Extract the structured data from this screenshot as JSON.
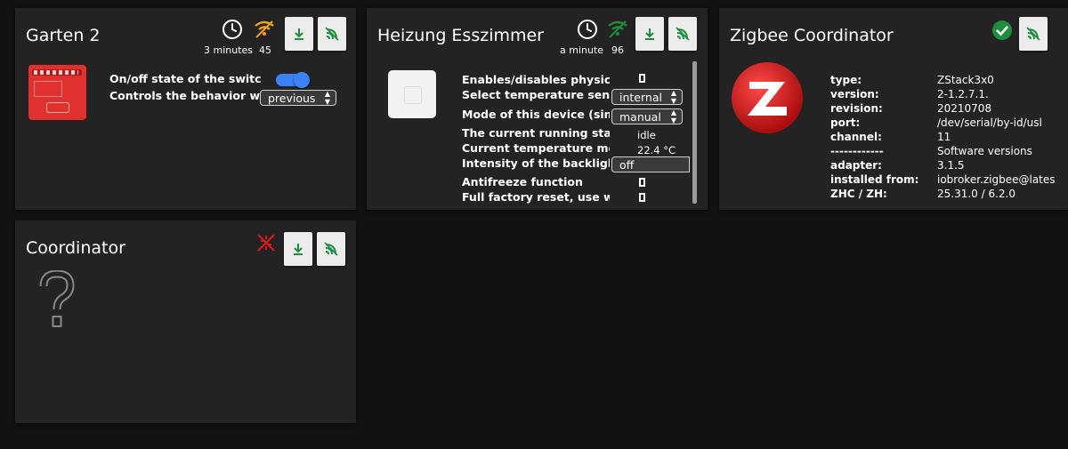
{
  "colors": {
    "background": "#121212",
    "card": "#232323",
    "link_ok": "#1e8e3e",
    "link_medium": "#f0a020",
    "error": "#e01818",
    "toggle": "#3b82f6"
  },
  "cards": {
    "garten": {
      "title": "Garten 2",
      "last_seen": "3 minutes",
      "link_quality": "45",
      "icons": [
        "clock-icon",
        "wifi-icon",
        "download-icon",
        "signal-icon"
      ],
      "rows": [
        {
          "label": "On/off state of the switch",
          "type": "toggle",
          "checked": true
        },
        {
          "label": "Controls the behavior w...",
          "type": "select",
          "value": "previous"
        }
      ]
    },
    "heizung": {
      "title": "Heizung Esszimmer",
      "last_seen": "a minute",
      "link_quality": "96",
      "icons": [
        "clock-icon",
        "wifi-icon",
        "download-icon",
        "signal-icon"
      ],
      "rows": [
        {
          "label": "Enables/disables physic...",
          "type": "checkbox"
        },
        {
          "label": "Select temperature sens...",
          "type": "select",
          "value": "internal"
        },
        {
          "label": "Mode of this device (sim...",
          "type": "select",
          "value": "manual"
        },
        {
          "label": "The current running state",
          "type": "text",
          "value": "idle"
        },
        {
          "label": "Current temperature me...",
          "type": "text",
          "value": "22.4 °C"
        },
        {
          "label": "Intensity of the backlight",
          "type": "select",
          "value": "off"
        },
        {
          "label": "Antifreeze function",
          "type": "checkbox"
        },
        {
          "label": "Full factory reset, use wi",
          "type": "checkbox"
        }
      ]
    },
    "zigbee": {
      "title": "Zigbee Coordinator",
      "icons": [
        "check-icon",
        "signal-icon"
      ],
      "info": [
        {
          "key": "type:",
          "value": "ZStack3x0"
        },
        {
          "key": "version:",
          "value": "2-1.2.7.1."
        },
        {
          "key": "revision:",
          "value": "20210708"
        },
        {
          "key": "port:",
          "value": "/dev/serial/by-id/usl"
        },
        {
          "key": "channel:",
          "value": "11"
        },
        {
          "key": "------------",
          "value": "Software versions"
        },
        {
          "key": "adapter:",
          "value": "3.1.5"
        },
        {
          "key": "installed from:",
          "value": "iobroker.zigbee@lates"
        },
        {
          "key": "ZHC / ZH:",
          "value": "25.31.0 / 6.2.0"
        }
      ]
    },
    "coordinator": {
      "title": "Coordinator",
      "icons": [
        "no-connection-icon",
        "download-icon",
        "signal-icon"
      ]
    }
  }
}
